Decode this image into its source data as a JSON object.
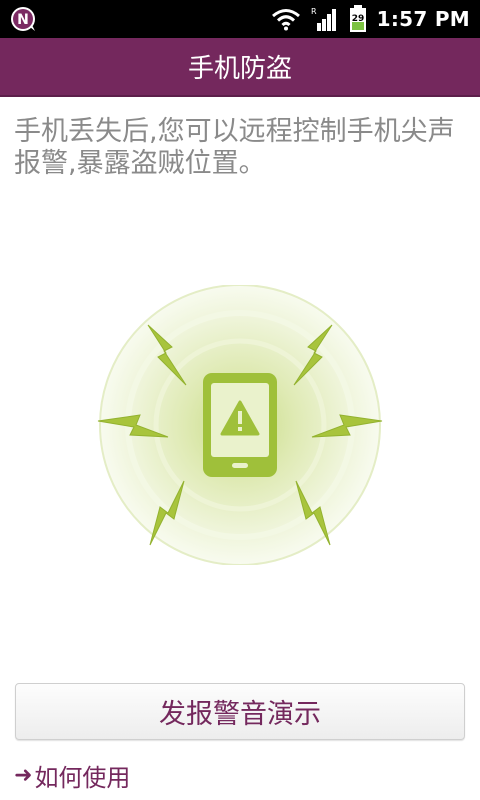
{
  "statusbar": {
    "notification_icon": "app-n-icon",
    "wifi_icon": "wifi-icon",
    "signal_icon": "signal-icon",
    "signal_roaming": "R",
    "battery_icon": "battery-icon",
    "battery_level": "29",
    "time": "1:57 PM"
  },
  "titlebar": {
    "title": "手机防盗"
  },
  "main": {
    "description": "手机丢失后,您可以远程控制手机尖声报警,暴露盗贼位置。",
    "illustration_icon": "alarming-phone-icon"
  },
  "actions": {
    "demo_button_label": "发报警音演示",
    "howto_arrow": "➜",
    "howto_link_label": "如何使用"
  },
  "colors": {
    "accent": "#74285d",
    "illustration_green": "#a3c53d",
    "statusbar": "#000000"
  }
}
